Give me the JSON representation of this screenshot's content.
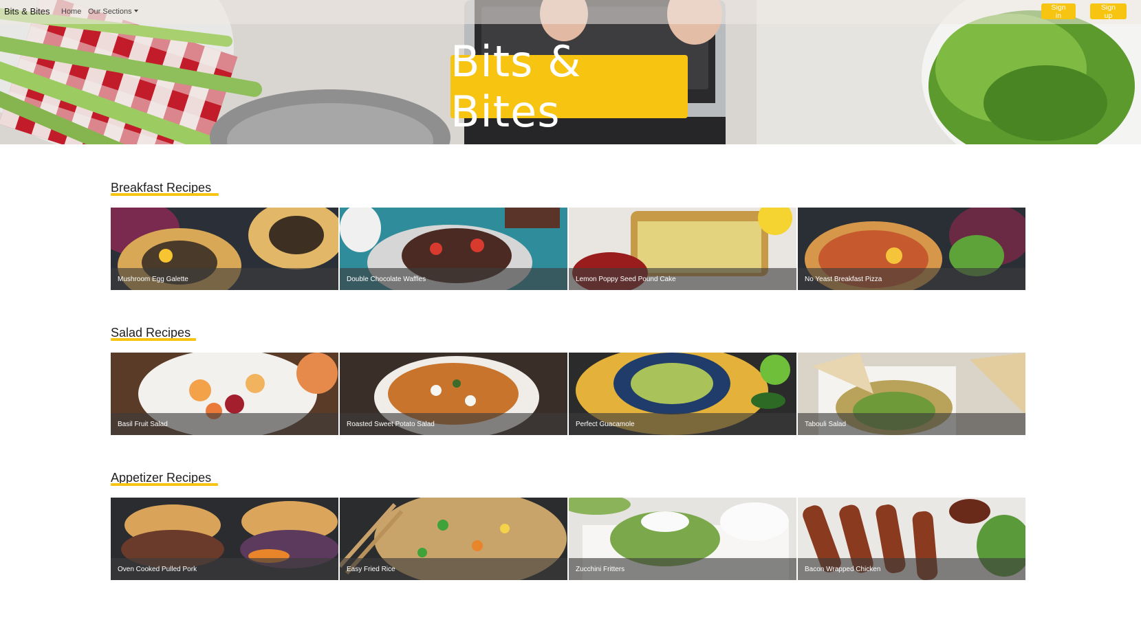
{
  "navbar": {
    "brand": "Bits & Bites",
    "home": "Home",
    "sections": "Our Sections",
    "sign_in": "Sign in",
    "sign_up": "Sign up"
  },
  "hero": {
    "title": "Bits & Bites"
  },
  "colors": {
    "accent": "#f7c412",
    "overlay": "#3c3c3c"
  },
  "sections": [
    {
      "title": "Breakfast Recipes",
      "recipes": [
        "Mushroom Egg Galette",
        "Double Chocolate Waffles",
        "Lemon Poppy Seed Pound Cake",
        "No Yeast Breakfast Pizza"
      ]
    },
    {
      "title": "Salad Recipes",
      "recipes": [
        "Basil Fruit Salad",
        "Roasted Sweet Potato Salad",
        "Perfect Guacamole",
        "Tabouli Salad"
      ]
    },
    {
      "title": "Appetizer Recipes",
      "recipes": [
        "Oven Cooked Pulled Pork",
        "Easy Fried Rice",
        "Zucchini Fritters",
        "Bacon Wrapped Chicken"
      ]
    }
  ]
}
